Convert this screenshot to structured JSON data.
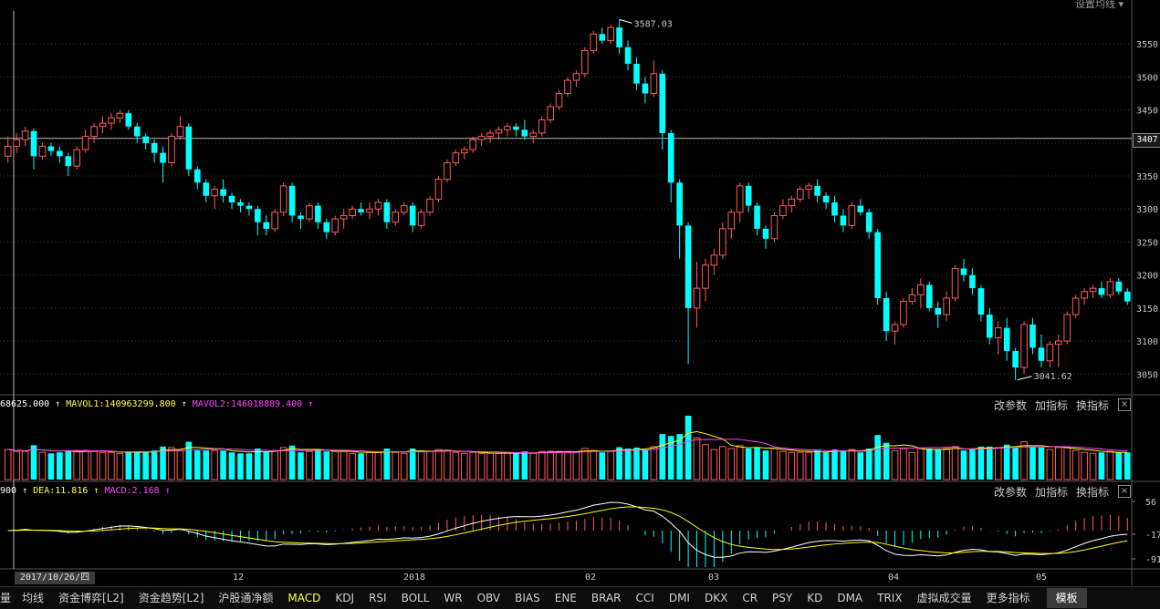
{
  "ma_settings_label": "设置均线",
  "price_axis": {
    "ticks": [
      "3550",
      "3500",
      "3450",
      "3400",
      "3350",
      "3300",
      "3250",
      "3200",
      "3150",
      "3100",
      "3050"
    ]
  },
  "crosshair_price": "3407",
  "annotations": {
    "high": "3587.03",
    "low": "3041.62"
  },
  "volume_panel": {
    "vol_value": "68625.000",
    "mavol1": "MAVOL1:140963299.800",
    "mavol2": "MAVOL2:146018889.400",
    "controls": {
      "params": "改参数",
      "add": "加指标",
      "switch": "换指标",
      "close": "×"
    }
  },
  "macd_panel": {
    "dif_value": "900",
    "dea": "DEA:11.816",
    "macd": "MACD:2.168",
    "controls": {
      "params": "改参数",
      "add": "加指标",
      "switch": "换指标",
      "close": "×"
    },
    "axis_ticks": [
      "56",
      "-17",
      "-91"
    ]
  },
  "x_axis": {
    "selected_date": "2017/10/26/四",
    "labels": [
      "12",
      "2018",
      "02",
      "03",
      "04",
      "05"
    ]
  },
  "tabs": {
    "left_edge": "量",
    "items": [
      "均线",
      "资金博弈[L2]",
      "资金趋势[L2]",
      "沪股通净额",
      "MACD",
      "KDJ",
      "RSI",
      "BOLL",
      "WR",
      "OBV",
      "BIAS",
      "ENE",
      "BRAR",
      "CCI",
      "DMI",
      "DKX",
      "CR",
      "PSY",
      "KD",
      "DMA",
      "TRIX",
      "虚拟成交量",
      "更多指标"
    ],
    "active": "MACD",
    "template": "模板"
  },
  "colors": {
    "up": "#ff5a5a",
    "down": "#00ffff",
    "ma_white": "#ffffff",
    "ma_yellow": "#ffff00",
    "ma_magenta": "#ff44ff"
  },
  "chart_data": {
    "type": "candlestick",
    "title": "",
    "ylim": [
      3020,
      3600
    ],
    "ohlc": [
      [
        3380,
        3410,
        3370,
        3395
      ],
      [
        3395,
        3415,
        3385,
        3405
      ],
      [
        3405,
        3425,
        3395,
        3418
      ],
      [
        3418,
        3422,
        3360,
        3380
      ],
      [
        3380,
        3400,
        3375,
        3395
      ],
      [
        3395,
        3400,
        3380,
        3388
      ],
      [
        3388,
        3395,
        3370,
        3380
      ],
      [
        3380,
        3385,
        3350,
        3365
      ],
      [
        3365,
        3395,
        3360,
        3390
      ],
      [
        3390,
        3420,
        3385,
        3410
      ],
      [
        3410,
        3430,
        3400,
        3425
      ],
      [
        3425,
        3440,
        3415,
        3430
      ],
      [
        3430,
        3445,
        3420,
        3438
      ],
      [
        3438,
        3450,
        3430,
        3445
      ],
      [
        3445,
        3450,
        3420,
        3425
      ],
      [
        3425,
        3430,
        3400,
        3410
      ],
      [
        3410,
        3415,
        3390,
        3400
      ],
      [
        3400,
        3405,
        3370,
        3385
      ],
      [
        3385,
        3395,
        3340,
        3370
      ],
      [
        3370,
        3415,
        3365,
        3410
      ],
      [
        3410,
        3440,
        3405,
        3425
      ],
      [
        3425,
        3430,
        3350,
        3360
      ],
      [
        3360,
        3365,
        3330,
        3340
      ],
      [
        3340,
        3345,
        3310,
        3320
      ],
      [
        3320,
        3335,
        3300,
        3330
      ],
      [
        3330,
        3345,
        3310,
        3320
      ],
      [
        3320,
        3325,
        3300,
        3310
      ],
      [
        3310,
        3315,
        3295,
        3305
      ],
      [
        3305,
        3310,
        3290,
        3300
      ],
      [
        3300,
        3305,
        3260,
        3280
      ],
      [
        3280,
        3290,
        3260,
        3270
      ],
      [
        3270,
        3300,
        3265,
        3295
      ],
      [
        3295,
        3340,
        3290,
        3335
      ],
      [
        3335,
        3340,
        3280,
        3290
      ],
      [
        3290,
        3295,
        3270,
        3285
      ],
      [
        3285,
        3310,
        3280,
        3305
      ],
      [
        3305,
        3310,
        3270,
        3280
      ],
      [
        3280,
        3285,
        3255,
        3265
      ],
      [
        3265,
        3290,
        3260,
        3285
      ],
      [
        3285,
        3300,
        3270,
        3290
      ],
      [
        3290,
        3305,
        3285,
        3300
      ],
      [
        3300,
        3310,
        3290,
        3295
      ],
      [
        3295,
        3310,
        3285,
        3300
      ],
      [
        3300,
        3315,
        3290,
        3310
      ],
      [
        3310,
        3315,
        3270,
        3280
      ],
      [
        3280,
        3300,
        3275,
        3295
      ],
      [
        3295,
        3310,
        3290,
        3305
      ],
      [
        3305,
        3310,
        3265,
        3275
      ],
      [
        3275,
        3300,
        3270,
        3295
      ],
      [
        3295,
        3320,
        3290,
        3315
      ],
      [
        3315,
        3350,
        3310,
        3345
      ],
      [
        3345,
        3375,
        3340,
        3370
      ],
      [
        3370,
        3390,
        3365,
        3385
      ],
      [
        3385,
        3395,
        3375,
        3390
      ],
      [
        3390,
        3410,
        3385,
        3405
      ],
      [
        3405,
        3415,
        3395,
        3410
      ],
      [
        3410,
        3420,
        3400,
        3415
      ],
      [
        3415,
        3425,
        3405,
        3420
      ],
      [
        3420,
        3430,
        3410,
        3425
      ],
      [
        3425,
        3430,
        3410,
        3420
      ],
      [
        3420,
        3435,
        3405,
        3410
      ],
      [
        3410,
        3420,
        3400,
        3415
      ],
      [
        3415,
        3440,
        3410,
        3435
      ],
      [
        3435,
        3460,
        3430,
        3455
      ],
      [
        3455,
        3480,
        3450,
        3475
      ],
      [
        3475,
        3500,
        3470,
        3495
      ],
      [
        3495,
        3510,
        3485,
        3505
      ],
      [
        3505,
        3545,
        3500,
        3540
      ],
      [
        3540,
        3570,
        3535,
        3565
      ],
      [
        3565,
        3575,
        3550,
        3555
      ],
      [
        3555,
        3580,
        3550,
        3575
      ],
      [
        3575,
        3587,
        3535,
        3545
      ],
      [
        3545,
        3555,
        3510,
        3520
      ],
      [
        3520,
        3530,
        3480,
        3490
      ],
      [
        3490,
        3500,
        3460,
        3475
      ],
      [
        3475,
        3525,
        3470,
        3505
      ],
      [
        3505,
        3510,
        3390,
        3415
      ],
      [
        3415,
        3420,
        3310,
        3340
      ],
      [
        3340,
        3345,
        3225,
        3275
      ],
      [
        3275,
        3280,
        3065,
        3150
      ],
      [
        3150,
        3220,
        3120,
        3180
      ],
      [
        3180,
        3225,
        3160,
        3215
      ],
      [
        3215,
        3240,
        3200,
        3230
      ],
      [
        3230,
        3280,
        3225,
        3270
      ],
      [
        3270,
        3300,
        3255,
        3295
      ],
      [
        3295,
        3340,
        3280,
        3335
      ],
      [
        3335,
        3340,
        3295,
        3305
      ],
      [
        3305,
        3310,
        3260,
        3270
      ],
      [
        3270,
        3275,
        3240,
        3255
      ],
      [
        3255,
        3295,
        3250,
        3290
      ],
      [
        3290,
        3315,
        3285,
        3305
      ],
      [
        3305,
        3320,
        3295,
        3315
      ],
      [
        3315,
        3335,
        3310,
        3330
      ],
      [
        3330,
        3340,
        3315,
        3335
      ],
      [
        3335,
        3345,
        3310,
        3320
      ],
      [
        3320,
        3325,
        3300,
        3310
      ],
      [
        3310,
        3320,
        3280,
        3290
      ],
      [
        3290,
        3300,
        3265,
        3275
      ],
      [
        3275,
        3310,
        3270,
        3305
      ],
      [
        3305,
        3315,
        3290,
        3295
      ],
      [
        3295,
        3300,
        3255,
        3265
      ],
      [
        3265,
        3270,
        3155,
        3165
      ],
      [
        3165,
        3175,
        3100,
        3115
      ],
      [
        3115,
        3130,
        3095,
        3125
      ],
      [
        3125,
        3165,
        3120,
        3160
      ],
      [
        3160,
        3180,
        3155,
        3170
      ],
      [
        3170,
        3195,
        3150,
        3185
      ],
      [
        3185,
        3190,
        3145,
        3150
      ],
      [
        3150,
        3160,
        3120,
        3140
      ],
      [
        3140,
        3175,
        3130,
        3165
      ],
      [
        3165,
        3215,
        3160,
        3210
      ],
      [
        3210,
        3225,
        3190,
        3200
      ],
      [
        3200,
        3210,
        3170,
        3180
      ],
      [
        3180,
        3185,
        3130,
        3140
      ],
      [
        3140,
        3150,
        3095,
        3105
      ],
      [
        3105,
        3130,
        3080,
        3120
      ],
      [
        3120,
        3135,
        3070,
        3085
      ],
      [
        3085,
        3090,
        3041,
        3060
      ],
      [
        3060,
        3130,
        3050,
        3125
      ],
      [
        3125,
        3135,
        3080,
        3090
      ],
      [
        3090,
        3110,
        3060,
        3070
      ],
      [
        3070,
        3100,
        3060,
        3095
      ],
      [
        3095,
        3110,
        3060,
        3100
      ],
      [
        3100,
        3145,
        3095,
        3140
      ],
      [
        3140,
        3170,
        3135,
        3165
      ],
      [
        3165,
        3180,
        3155,
        3175
      ],
      [
        3175,
        3185,
        3165,
        3180
      ],
      [
        3180,
        3190,
        3165,
        3170
      ],
      [
        3170,
        3195,
        3165,
        3190
      ],
      [
        3190,
        3195,
        3170,
        3175
      ],
      [
        3175,
        3180,
        3155,
        3160
      ]
    ]
  }
}
